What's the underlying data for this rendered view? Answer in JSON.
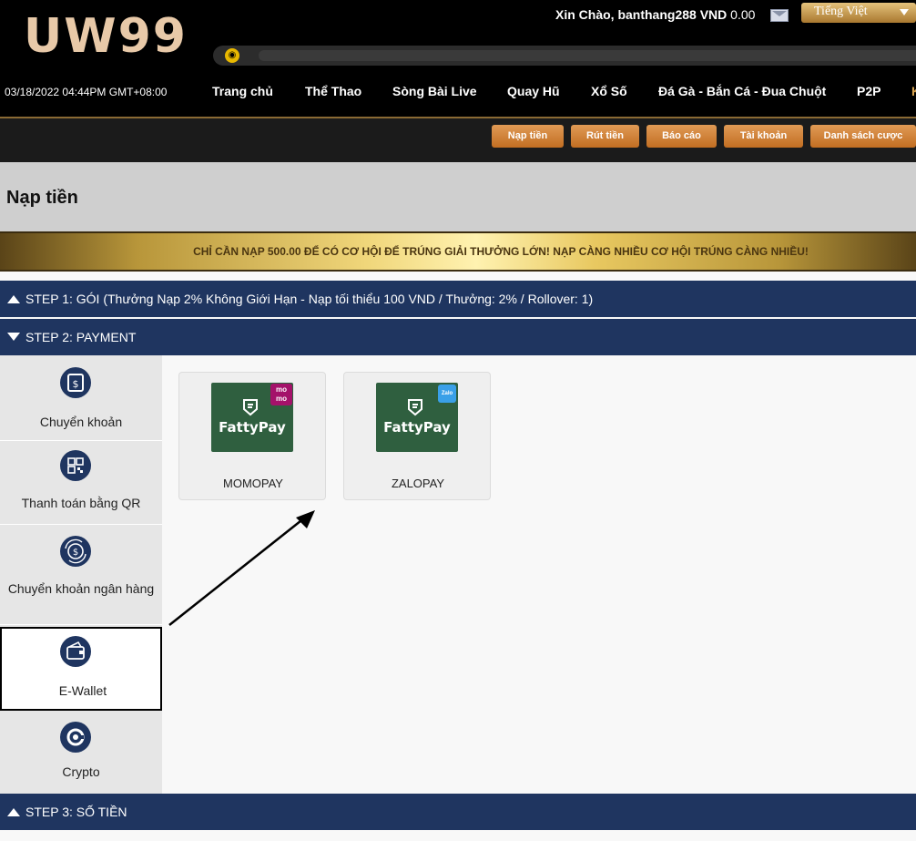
{
  "header": {
    "logo": "UW99",
    "greeting_prefix": "Xin Chào, banthang288",
    "currency": "VND",
    "balance": "0.00",
    "language": "Tiếng Việt",
    "datetime": "03/18/2022 04:44PM GMT+08:00",
    "nav": [
      {
        "label": "Trang chủ"
      },
      {
        "label": "Thể Thao"
      },
      {
        "label": "Sòng Bài Live"
      },
      {
        "label": "Quay Hũ"
      },
      {
        "label": "Xổ Số"
      },
      {
        "label": "Đá Gà - Bắn Cá - Đua Chuột"
      },
      {
        "label": "P2P"
      },
      {
        "label": "K"
      }
    ]
  },
  "subnav": {
    "buttons": [
      {
        "label": "Nạp tiền"
      },
      {
        "label": "Rút tiền"
      },
      {
        "label": "Báo cáo"
      },
      {
        "label": "Tài khoản"
      },
      {
        "label": "Danh sách cược"
      }
    ]
  },
  "page": {
    "title": "Nạp tiền",
    "promo": "CHỈ CẦN NẠP 500.00 ĐỂ CÓ CƠ HỘI ĐỂ TRÚNG GIẢI THƯỞNG LỚN! NẠP CÀNG NHIỀU CƠ HỘI TRÚNG CÀNG NHIỀU!"
  },
  "steps": {
    "step1": "STEP 1: GÓI (Thưởng Nạp 2% Không Giới Hạn - Nạp tối thiểu 100 VND / Thưởng: 2% / Rollover: 1)",
    "step2": "STEP 2: PAYMENT",
    "step3": "STEP 3: SỐ TIỀN"
  },
  "methods": [
    {
      "label": "Chuyển khoản",
      "icon": "bank-transfer-icon"
    },
    {
      "label": "Thanh toán bằng QR",
      "icon": "qr-code-icon"
    },
    {
      "label": "Chuyển khoản ngân hàng",
      "icon": "bank-exchange-icon"
    },
    {
      "label": "E-Wallet",
      "icon": "wallet-icon",
      "selected": true
    },
    {
      "label": "Crypto",
      "icon": "crypto-icon"
    }
  ],
  "wallets": [
    {
      "name": "MOMOPAY",
      "brand": "FattyPay",
      "badge": "mo mo"
    },
    {
      "name": "ZALOPAY",
      "brand": "FattyPay",
      "badge": "Zalo"
    }
  ],
  "colors": {
    "navy": "#1f3560",
    "gold": "#c26e22",
    "fattypay_green": "#2f5f3f",
    "momo_pink": "#a4126a"
  }
}
